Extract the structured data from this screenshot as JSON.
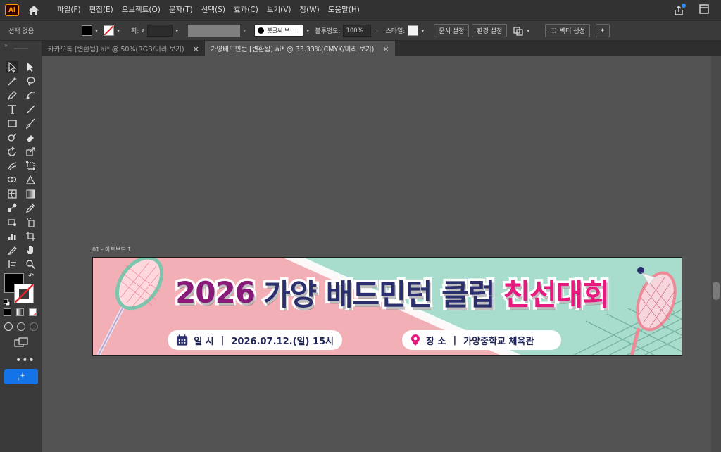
{
  "app": {
    "logo": "Ai"
  },
  "menu": [
    "파일(F)",
    "편집(E)",
    "오브젝트(O)",
    "문자(T)",
    "선택(S)",
    "효과(C)",
    "보기(V)",
    "창(W)",
    "도움말(H)"
  ],
  "control_bar": {
    "selection": "선택 없음",
    "stroke_label": "획:",
    "brush": "붓글씨 브...",
    "opacity_label": "불투명도:",
    "opacity_value": "100%",
    "style_label": "스타일:",
    "doc_setup": "문서 설정",
    "preferences": "환경 설정",
    "vector_gen": "벡터 생성"
  },
  "tabs": [
    {
      "label": "카카오톡 [변환됨].ai* @ 50%(RGB/미리 보기)",
      "active": false
    },
    {
      "label": "가양배드민턴 [변환됨].ai* @ 33.33%(CMYK/미리 보기)",
      "active": true
    }
  ],
  "artboard": {
    "label": "01 - 아트보드 1",
    "title_year": "2026",
    "title_main": "가양 배드민턴 클럽",
    "title_highlight": "친선대회",
    "date_label": "일 시",
    "date_value": "2026.07.12.(일) 15시",
    "place_label": "장 소",
    "place_value": "가양중학교 체육관",
    "separator": "|"
  },
  "colors": {
    "banner_pink": "#f2b0b6",
    "banner_mint": "#a8dccd",
    "title_navy": "#2b2f6e",
    "title_purple": "#8a1a7a",
    "title_magenta": "#e5197e",
    "generative_blue": "#1473e6"
  }
}
